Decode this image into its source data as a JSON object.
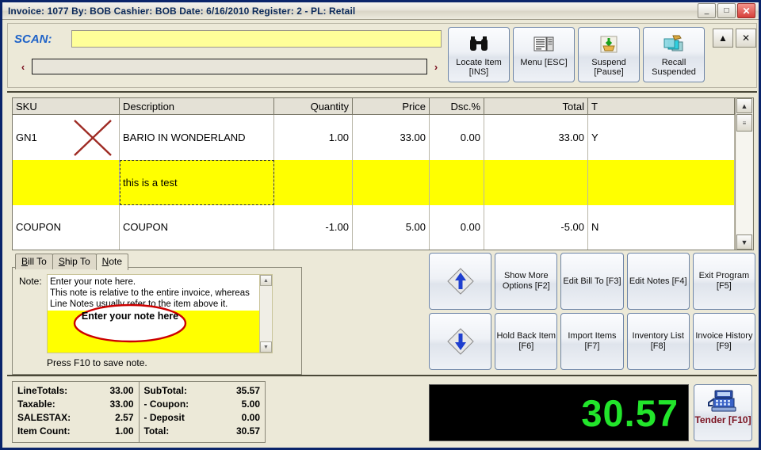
{
  "titlebar": {
    "text": "Invoice: 1077  By: BOB  Cashier: BOB   Date:  6/16/2010  Register: 2 - PL: Retail",
    "minimize": "_",
    "maximize": "□",
    "close": "✕"
  },
  "scan": {
    "label": "SCAN:",
    "scan_value": "",
    "scan_placeholder": "",
    "prev_arrow": "‹",
    "next_arrow": "›",
    "sku_value": "",
    "sku_placeholder": ""
  },
  "toolbar": {
    "buttons": [
      {
        "label": "Locate Item\n[INS]",
        "icon": "binoculars-icon"
      },
      {
        "label": "Menu [ESC]",
        "icon": "menu-list-icon"
      },
      {
        "label": "Suspend\n[Pause]",
        "icon": "suspend-basket-icon"
      },
      {
        "label": "Recall\nSuspended",
        "icon": "recall-windows-icon"
      }
    ],
    "collapse": "▲",
    "close": "✕"
  },
  "grid": {
    "columns": [
      "SKU",
      "Description",
      "Quantity",
      "Price",
      "Dsc.%",
      "Total",
      "T"
    ],
    "rows": [
      {
        "type": "item",
        "sku": "GN1",
        "description": "BARIO IN WONDERLAND",
        "quantity": "1.00",
        "price": "33.00",
        "dsc": "0.00",
        "total": "33.00",
        "t": "Y"
      },
      {
        "type": "note",
        "sku": "",
        "description": "this is a test",
        "quantity": "",
        "price": "",
        "dsc": "",
        "total": "",
        "t": ""
      },
      {
        "type": "item",
        "sku": "COUPON",
        "description": "COUPON",
        "quantity": "-1.00",
        "price": "5.00",
        "dsc": "0.00",
        "total": "-5.00",
        "t": "N"
      }
    ],
    "scroll_up": "▲",
    "scroll_down": "▼"
  },
  "tabs": [
    {
      "label": "Bill To",
      "active": false
    },
    {
      "label": "Ship To",
      "active": false
    },
    {
      "label": "Note",
      "active": true
    }
  ],
  "note": {
    "label": "Note:",
    "value": "Enter your note here.\nThis note is relative to the entire invoice, whereas Line Notes usually refer to the item above it.",
    "hint": "Press F10 to save note.",
    "scroll_up": "▲",
    "scroll_down": "▼"
  },
  "annotations": {
    "ellipse_text": "Enter your note\nhere",
    "ellipse_color": "#cc0000",
    "x_mark_color": "#9e2b24"
  },
  "actions": {
    "row1": [
      {
        "label": "",
        "icon": "arrow-up-diamond-icon"
      },
      {
        "label": "Show More\nOptions [F2]",
        "icon": ""
      },
      {
        "label": "Edit Bill To [F3]",
        "icon": ""
      },
      {
        "label": "Edit Notes [F4]",
        "icon": ""
      },
      {
        "label": "Exit Program\n[F5]",
        "icon": ""
      }
    ],
    "row2": [
      {
        "label": "",
        "icon": "arrow-down-diamond-icon"
      },
      {
        "label": "Hold Back Item\n[F6]",
        "icon": ""
      },
      {
        "label": "Import Items [F7]",
        "icon": ""
      },
      {
        "label": "Inventory List\n[F8]",
        "icon": ""
      },
      {
        "label": "Invoice History\n[F9]",
        "icon": ""
      }
    ]
  },
  "totals": {
    "left": [
      {
        "label": "LineTotals:",
        "value": "33.00"
      },
      {
        "label": "Taxable:",
        "value": "33.00"
      },
      {
        "label": "SALESTAX:",
        "value": "2.57"
      },
      {
        "label": "Item Count:",
        "value": "1.00"
      }
    ],
    "right": [
      {
        "label": "SubTotal:",
        "value": "35.57"
      },
      {
        "label": "- Coupon:",
        "value": "5.00"
      },
      {
        "label": "- Deposit",
        "value": "0.00"
      },
      {
        "label": "Total:",
        "value": "30.57"
      }
    ]
  },
  "display": {
    "amount": "30.57",
    "color": "#22e52b"
  },
  "tender": {
    "label": "Tender\n[F10]",
    "icon": "cash-register-icon",
    "color": "#7b1220"
  }
}
